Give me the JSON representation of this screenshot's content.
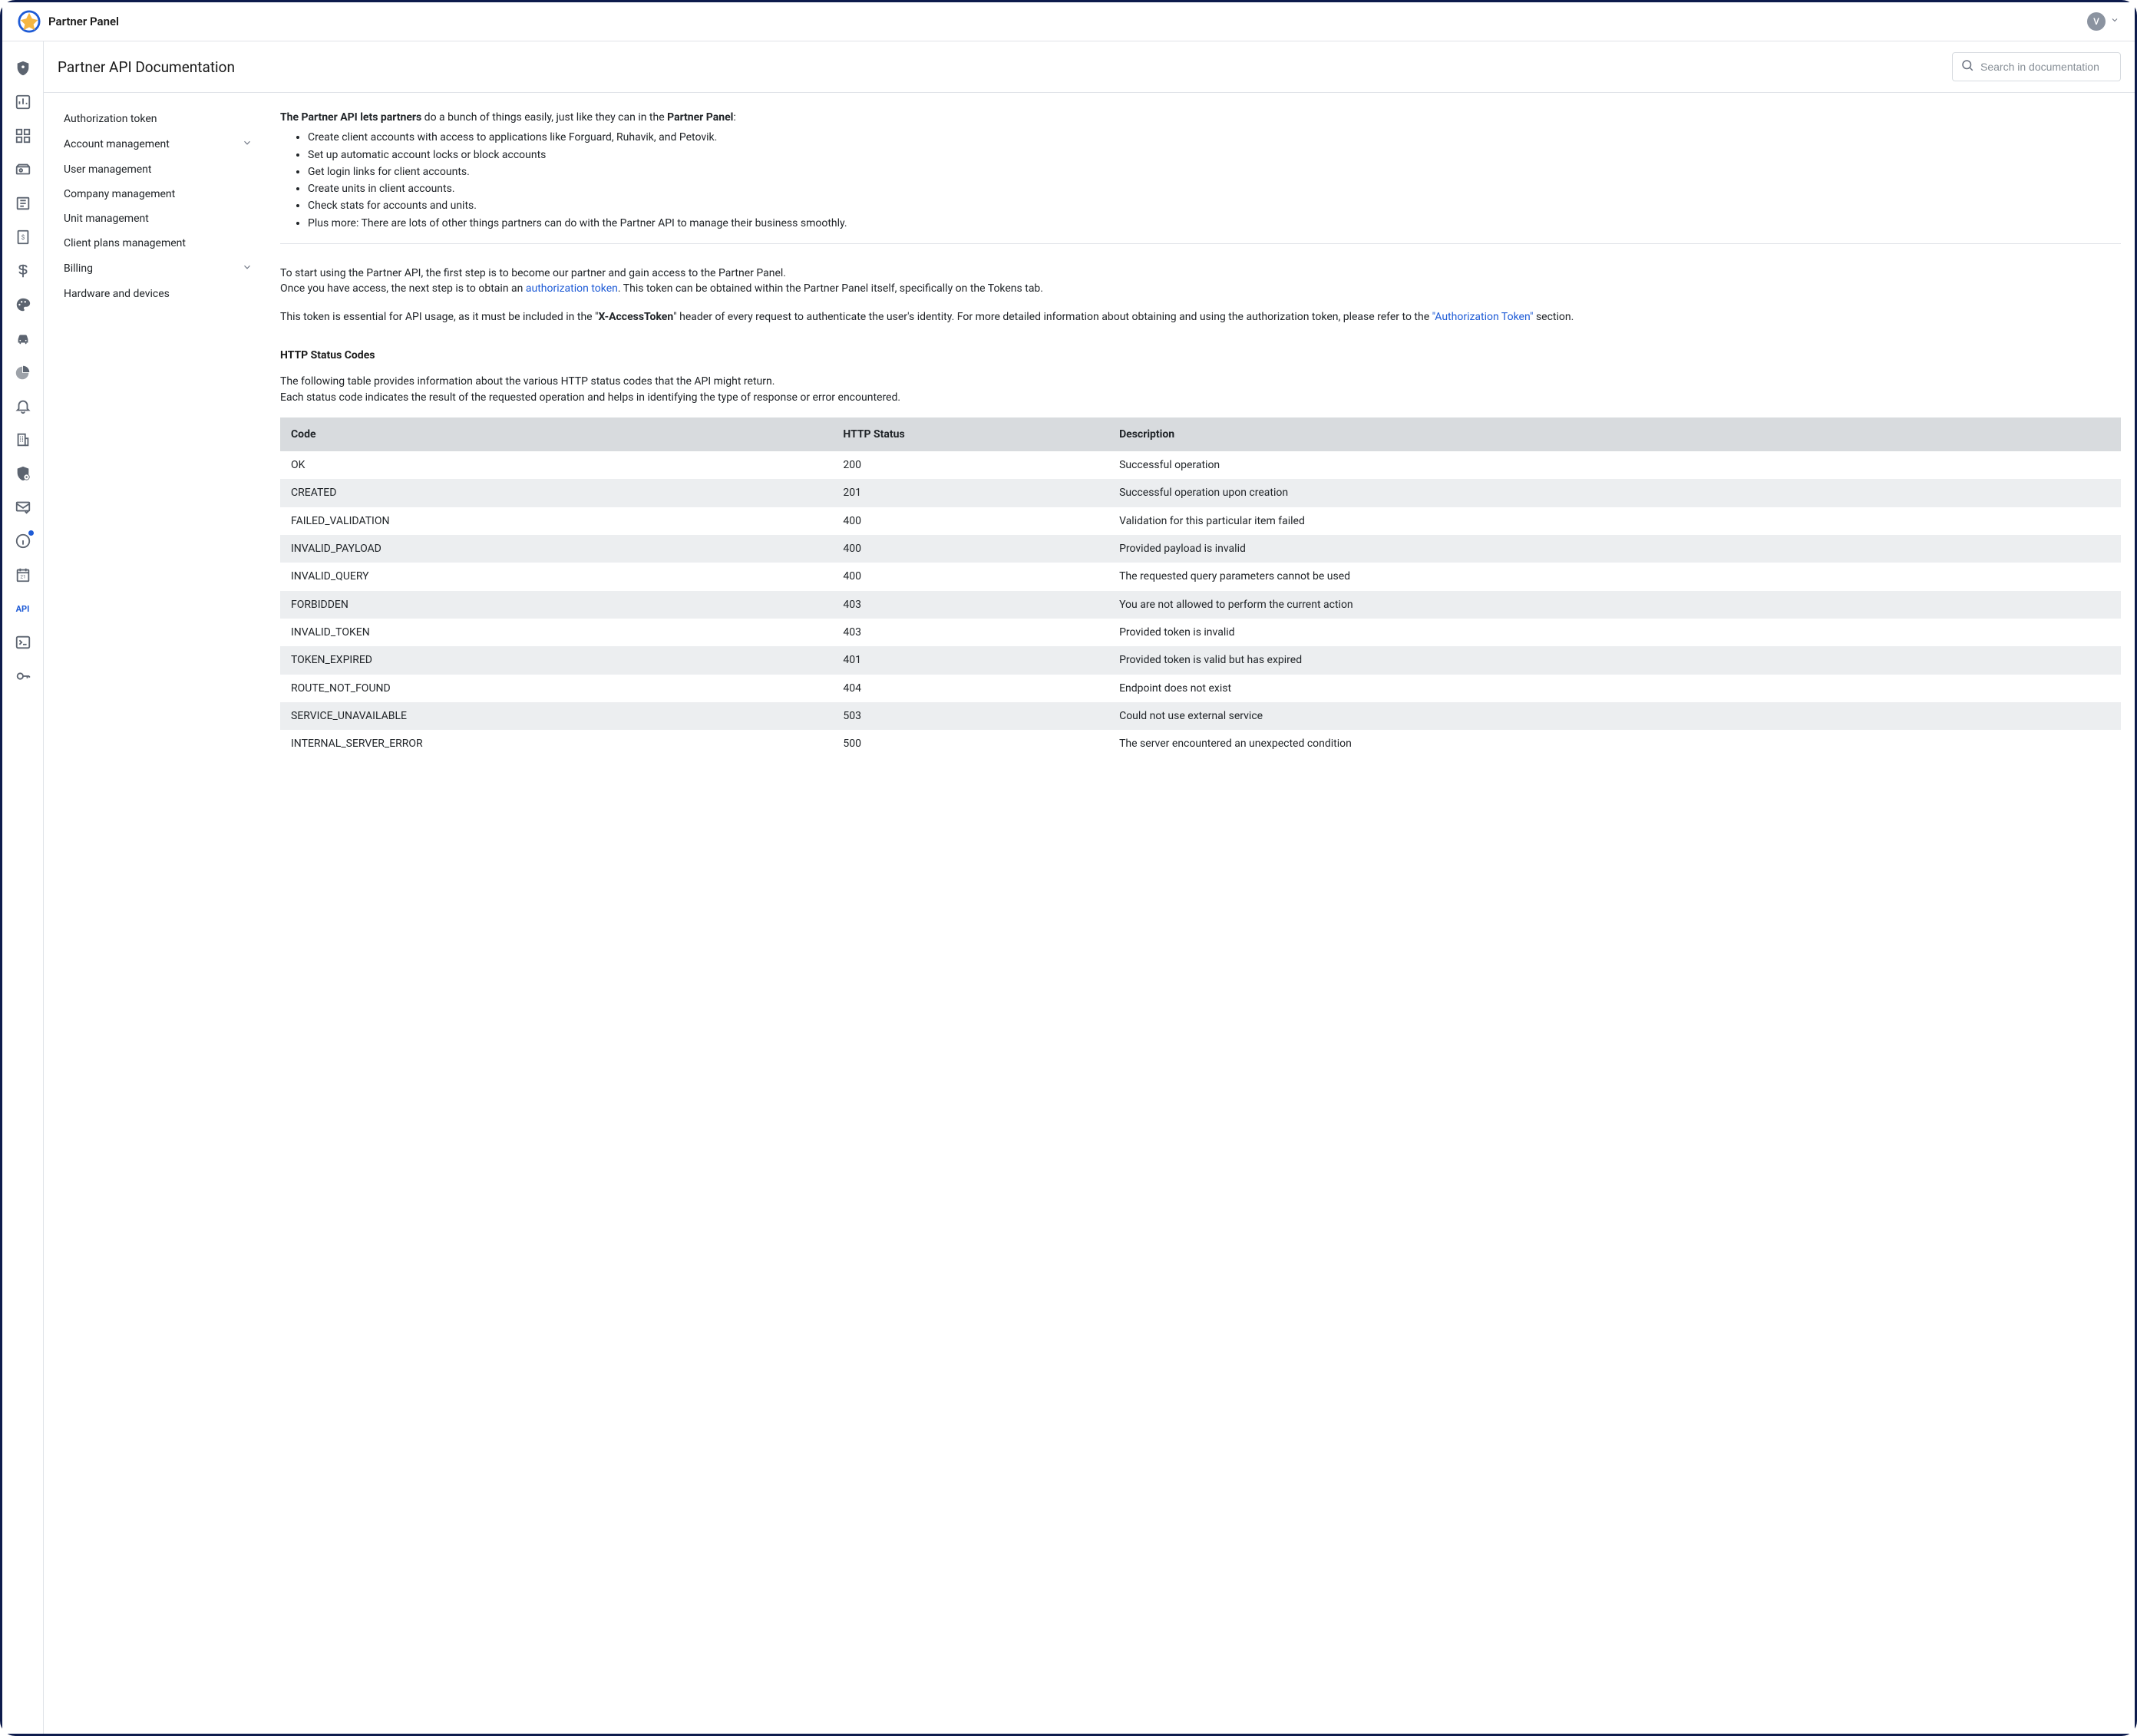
{
  "header": {
    "app_title": "Partner Panel",
    "avatar_initial": "V"
  },
  "search": {
    "placeholder": "Search in documentation"
  },
  "page": {
    "title": "Partner API Documentation"
  },
  "rail": {
    "api_label": "API"
  },
  "toc": {
    "items": [
      {
        "label": "Authorization token",
        "expandable": false
      },
      {
        "label": "Account management",
        "expandable": true
      },
      {
        "label": "User management",
        "expandable": false
      },
      {
        "label": "Company management",
        "expandable": false
      },
      {
        "label": "Unit management",
        "expandable": false
      },
      {
        "label": "Client plans management",
        "expandable": false
      },
      {
        "label": "Billing",
        "expandable": true
      },
      {
        "label": "Hardware and devices",
        "expandable": false
      }
    ]
  },
  "intro": {
    "lead_bold": "The Partner API lets partners",
    "lead_rest": " do a bunch of things easily, just like they can in the ",
    "lead_panel_bold": "Partner Panel",
    "lead_tail": ":",
    "bullets": [
      "Create client accounts with access to applications like Forguard, Ruhavik, and Petovik.",
      "Set up automatic account locks or block accounts",
      "Get login links for client accounts.",
      "Create units in client accounts.",
      "Check stats for accounts and units.",
      "Plus more: There are lots of other things partners can do with the Partner API to manage their business smoothly."
    ],
    "para1_line1": "To start using the Partner API, the first step is to become our partner and gain access to the Partner Panel.",
    "para1_line2_pre": "Once you have access, the next step is to obtain an ",
    "para1_link": "authorization token",
    "para1_line2_post": ". This token can be obtained within the Partner Panel itself, specifically on the Tokens tab.",
    "para2_pre": "This token is essential for API usage, as it must be included in the \"",
    "para2_bold": "X-AccessToken",
    "para2_mid": "\" header of every request to authenticate the user's identity. For more detailed information about obtaining and using the authorization token, please refer to the ",
    "para2_link": "\"Authorization Token\"",
    "para2_post": " section."
  },
  "status": {
    "heading": "HTTP Status Codes",
    "desc_line1": "The following table provides information about the various HTTP status codes that the API might return.",
    "desc_line2": "Each status code indicates the result of the requested operation and helps in identifying the type of response or error encountered.",
    "columns": [
      "Code",
      "HTTP Status",
      "Description"
    ],
    "rows": [
      {
        "code": "OK",
        "status": "200",
        "desc": "Successful operation"
      },
      {
        "code": "CREATED",
        "status": "201",
        "desc": "Successful operation upon creation"
      },
      {
        "code": "FAILED_VALIDATION",
        "status": "400",
        "desc": "Validation for this particular item failed"
      },
      {
        "code": "INVALID_PAYLOAD",
        "status": "400",
        "desc": "Provided payload is invalid"
      },
      {
        "code": "INVALID_QUERY",
        "status": "400",
        "desc": "The requested query parameters cannot be used"
      },
      {
        "code": "FORBIDDEN",
        "status": "403",
        "desc": "You are not allowed to perform the current action"
      },
      {
        "code": "INVALID_TOKEN",
        "status": "403",
        "desc": "Provided token is invalid"
      },
      {
        "code": "TOKEN_EXPIRED",
        "status": "401",
        "desc": "Provided token is valid but has expired"
      },
      {
        "code": "ROUTE_NOT_FOUND",
        "status": "404",
        "desc": "Endpoint does not exist"
      },
      {
        "code": "SERVICE_UNAVAILABLE",
        "status": "503",
        "desc": "Could not use external service"
      },
      {
        "code": "INTERNAL_SERVER_ERROR",
        "status": "500",
        "desc": "The server encountered an unexpected condition"
      }
    ]
  }
}
